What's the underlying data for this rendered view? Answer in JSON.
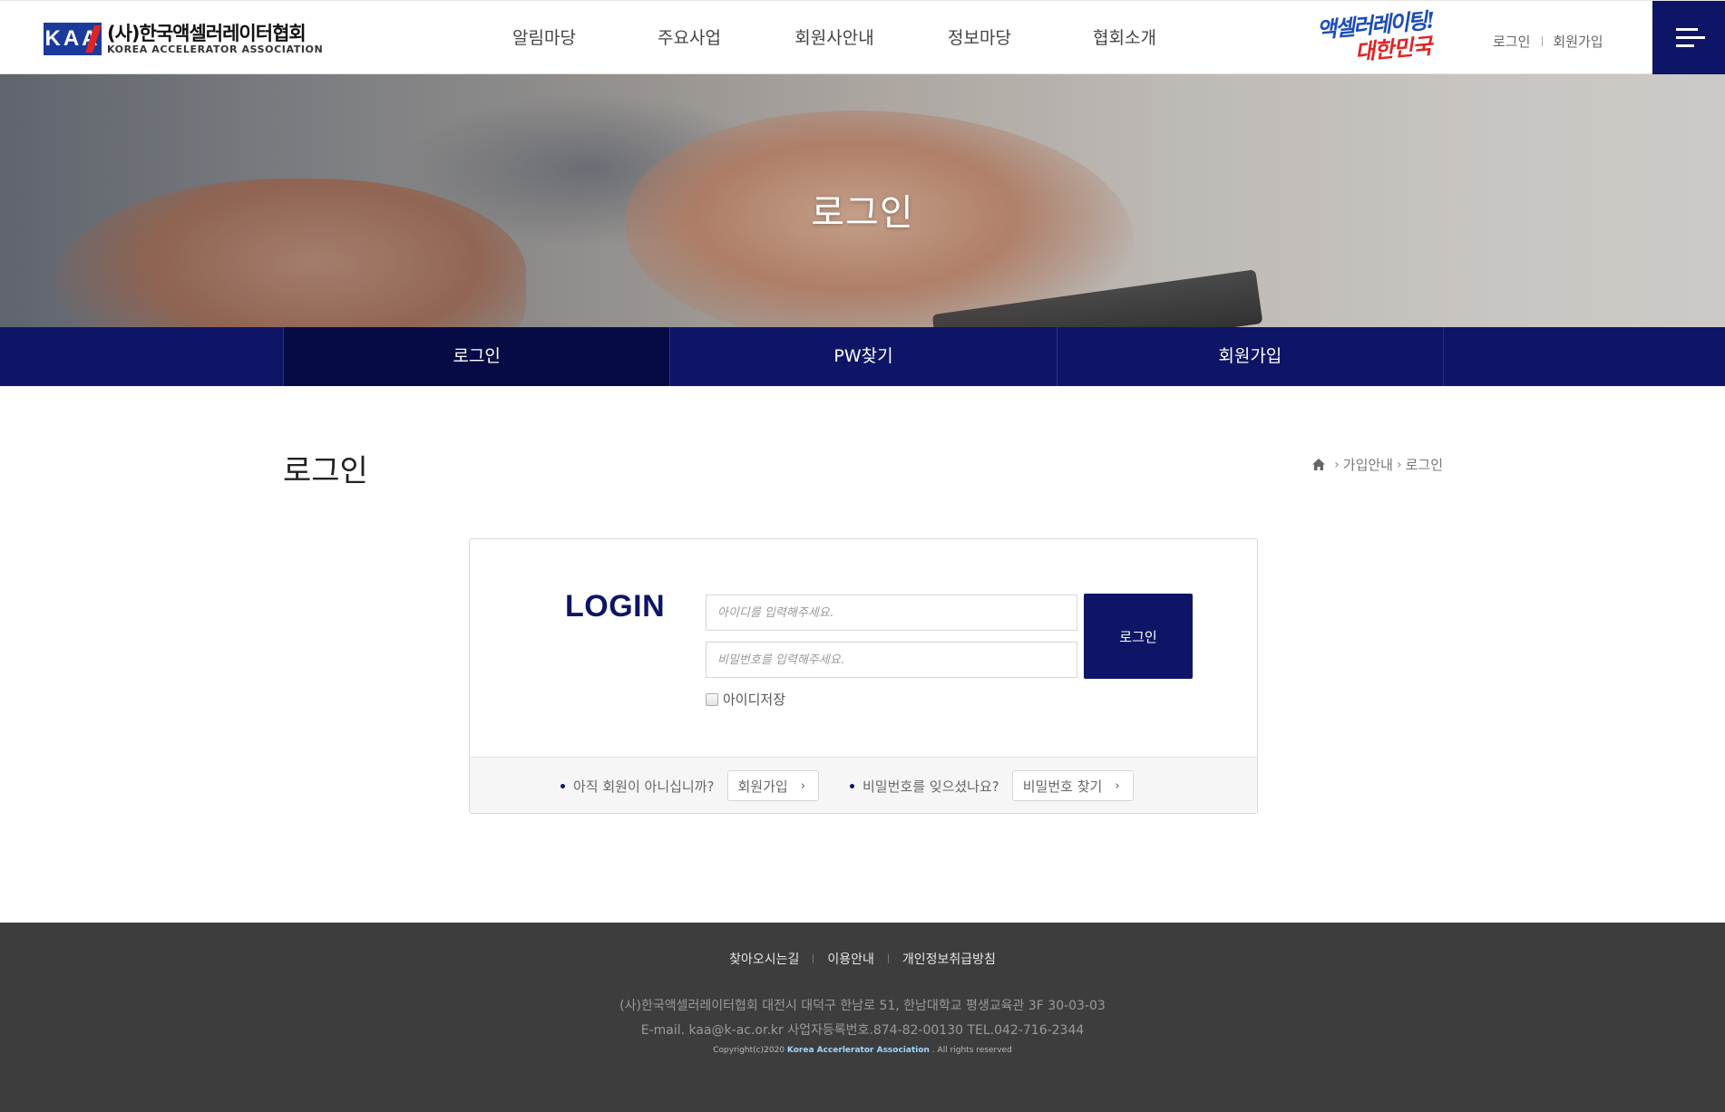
{
  "header": {
    "logo": {
      "mark": "KAA",
      "name_kor": "(사)한국액셀러레이터협회",
      "name_eng": "KOREA ACCELERATOR ASSOCIATION"
    },
    "nav": [
      "알림마당",
      "주요사업",
      "회원사안내",
      "정보마당",
      "협회소개"
    ],
    "slogan": {
      "line1": "액셀러레이팅!",
      "line2": "대한민국"
    },
    "util": {
      "login": "로그인",
      "join": "회원가입"
    },
    "menu_icon": "hamburger-icon"
  },
  "hero": {
    "title": "로그인"
  },
  "subnav": {
    "tabs": [
      "로그인",
      "PW찾기",
      "회원가입"
    ],
    "active_index": 0
  },
  "content": {
    "page_title": "로그인",
    "breadcrumb": {
      "home_icon": "home-icon",
      "items": [
        "가입안내",
        "로그인"
      ]
    }
  },
  "login": {
    "heading": "LOGIN",
    "id_placeholder": "아이디를 입력해주세요.",
    "pw_placeholder": "비밀번호를 입력해주세요.",
    "button": "로그인",
    "save_id": "아이디저장",
    "footer": {
      "not_member": "아직 회원이 아니십니까?",
      "join_button": "회원가입",
      "forgot": "비밀번호를 잊으셨나요?",
      "find_button": "비밀번호 찾기"
    }
  },
  "footer": {
    "links": [
      "찾아오시는길",
      "이용안내",
      "개인정보취급방침"
    ],
    "address": "(사)한국액셀러레이터협회 대전시 대덕구 한남로 51, 한남대학교 평생교육관 3F 30-03-03",
    "contact": "E-mail. kaa@k-ac.or.kr 사업자등록번호.874-82-00130 TEL.042-716-2344",
    "copyright_prefix": "Copyright(c)2020",
    "copyright_org": "Korea  Accerlerator Association",
    "copyright_suffix": ". All rights reserved"
  },
  "colors": {
    "brand_navy": "#0e1566",
    "brand_navy_dark": "#070b45",
    "logo_blue": "#1a3a9c",
    "logo_red": "#e02424",
    "footer_bg": "#3d3d3d"
  }
}
